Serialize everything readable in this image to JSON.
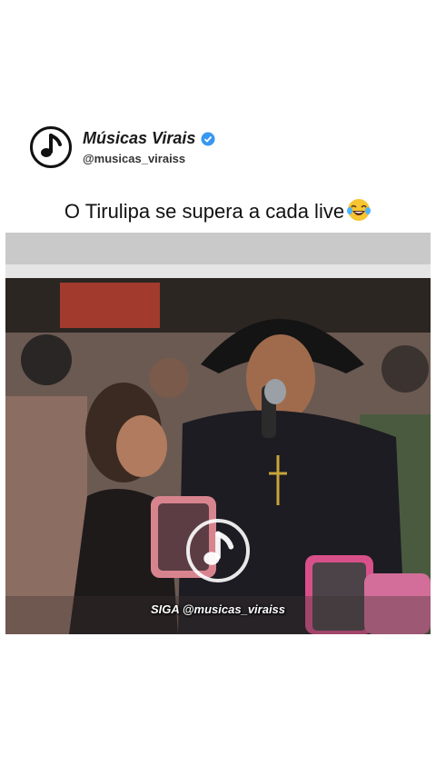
{
  "profile": {
    "name": "Músicas Virais",
    "handle": "@musicas_viraiss",
    "logo_icon": "music-note-icon",
    "verified_icon": "verified-badge-icon",
    "verified_color": "#3897f0"
  },
  "caption": {
    "text": "O Tirulipa se supera a cada live",
    "emoji": "face-with-tears-of-joy"
  },
  "video": {
    "watermark_icon": "music-note-icon",
    "watermark_text": "SIGA @musicas_viraiss"
  }
}
